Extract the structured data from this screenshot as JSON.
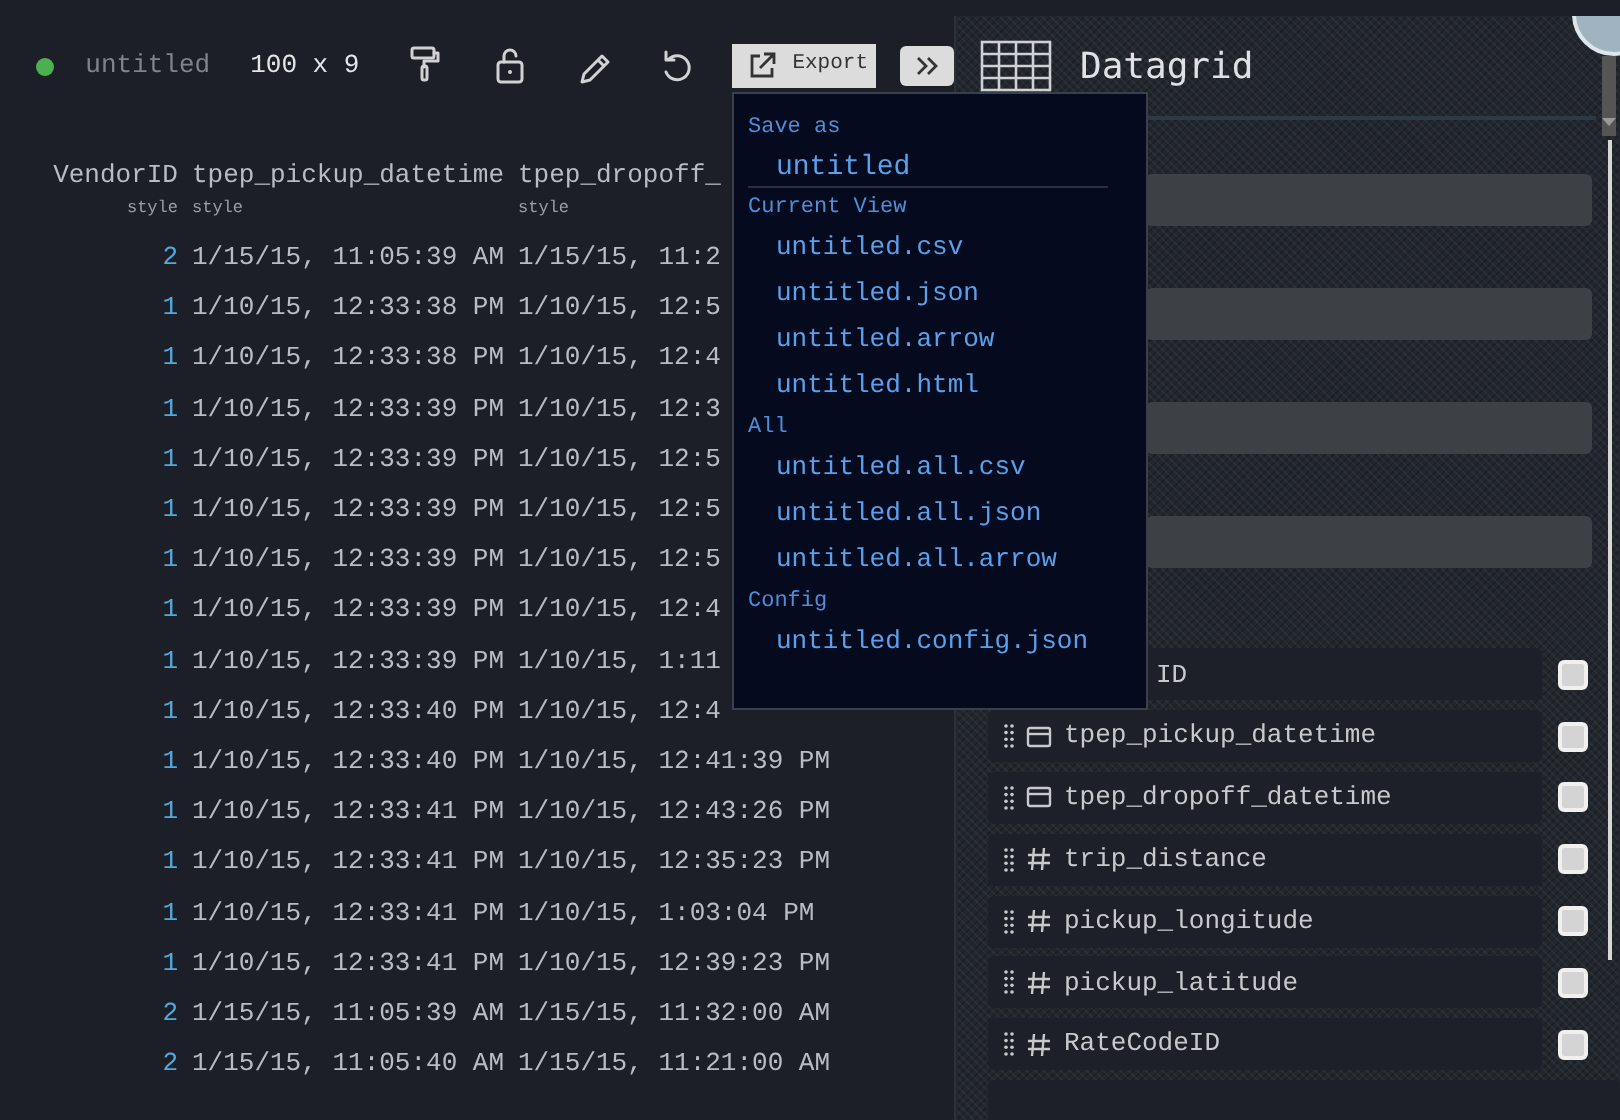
{
  "toolbar": {
    "title": "untitled",
    "size": "100 x 9",
    "export_label": "Export"
  },
  "grid": {
    "columns": [
      {
        "name": "VendorID",
        "sub": "style",
        "kind": "number"
      },
      {
        "name": "tpep_pickup_datetime",
        "sub": "style",
        "kind": "datetime"
      },
      {
        "name": "tpep_dropoff_",
        "sub": "style",
        "kind": "datetime"
      }
    ],
    "rows": [
      [
        "2",
        "1/15/15, 11:05:39 AM",
        "1/15/15, 11:2"
      ],
      [
        "1",
        "1/10/15, 12:33:38 PM",
        "1/10/15, 12:5"
      ],
      [
        "1",
        "1/10/15, 12:33:38 PM",
        "1/10/15, 12:4"
      ],
      [
        "1",
        "1/10/15, 12:33:39 PM",
        "1/10/15, 12:3"
      ],
      [
        "1",
        "1/10/15, 12:33:39 PM",
        "1/10/15, 12:5"
      ],
      [
        "1",
        "1/10/15, 12:33:39 PM",
        "1/10/15, 12:5"
      ],
      [
        "1",
        "1/10/15, 12:33:39 PM",
        "1/10/15, 12:5"
      ],
      [
        "1",
        "1/10/15, 12:33:39 PM",
        "1/10/15, 12:4"
      ],
      [
        "1",
        "1/10/15, 12:33:39 PM",
        "1/10/15, 1:11"
      ],
      [
        "1",
        "1/10/15, 12:33:40 PM",
        "1/10/15, 12:4"
      ],
      [
        "1",
        "1/10/15, 12:33:40 PM",
        "1/10/15, 12:41:39 PM"
      ],
      [
        "1",
        "1/10/15, 12:33:41 PM",
        "1/10/15, 12:43:26 PM"
      ],
      [
        "1",
        "1/10/15, 12:33:41 PM",
        "1/10/15, 12:35:23 PM"
      ],
      [
        "1",
        "1/10/15, 12:33:41 PM",
        "1/10/15, 1:03:04 PM"
      ],
      [
        "1",
        "1/10/15, 12:33:41 PM",
        "1/10/15, 12:39:23 PM"
      ],
      [
        "2",
        "1/15/15, 11:05:39 AM",
        "1/15/15, 11:32:00 AM"
      ],
      [
        "2",
        "1/15/15, 11:05:40 AM",
        "1/15/15, 11:21:00 AM"
      ]
    ]
  },
  "export_menu": {
    "sections": [
      {
        "heading": "Save as",
        "kind": "field",
        "items": [
          "untitled"
        ]
      },
      {
        "heading": "Current View",
        "kind": "links",
        "items": [
          "untitled.csv",
          "untitled.json",
          "untitled.arrow",
          "untitled.html"
        ]
      },
      {
        "heading": "All",
        "kind": "links",
        "items": [
          "untitled.all.csv",
          "untitled.all.json",
          "untitled.all.arrow"
        ]
      },
      {
        "heading": "Config",
        "kind": "links",
        "items": [
          "untitled.config.json"
        ]
      }
    ]
  },
  "panel": {
    "title": "Datagrid",
    "columns": [
      {
        "name": "ID",
        "checked": false
      },
      {
        "name": "tpep_pickup_datetime",
        "kind": "datetime",
        "checked": false
      },
      {
        "name": "tpep_dropoff_datetime",
        "kind": "datetime",
        "checked": false
      },
      {
        "name": "trip_distance",
        "kind": "number",
        "checked": false
      },
      {
        "name": "pickup_longitude",
        "kind": "number",
        "checked": false
      },
      {
        "name": "pickup_latitude",
        "kind": "number",
        "checked": false
      },
      {
        "name": "RateCodeID",
        "kind": "number",
        "checked": false
      }
    ]
  }
}
